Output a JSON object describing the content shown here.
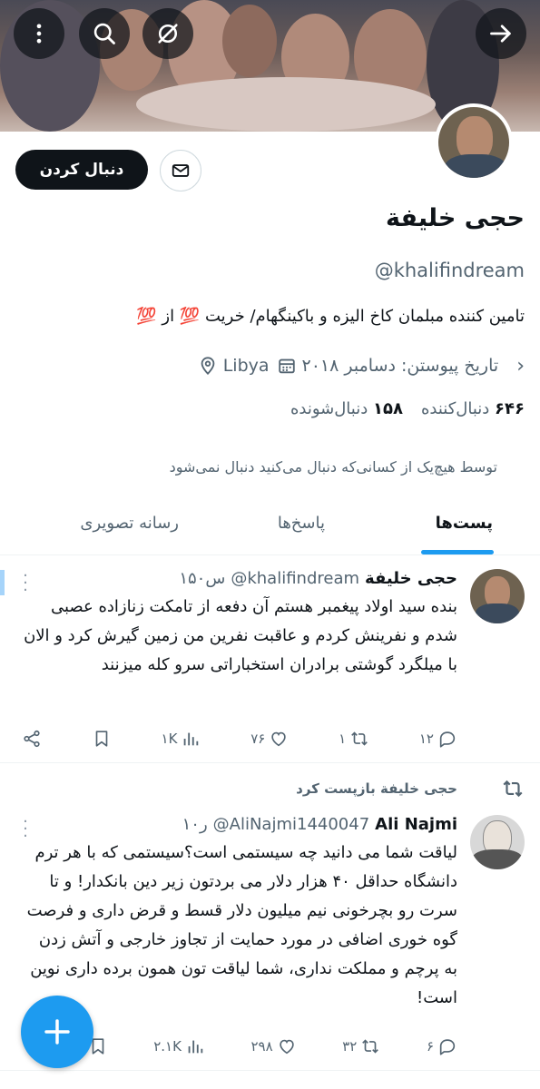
{
  "profile": {
    "name": "حجی خلیفة",
    "handle": "@khalifindream",
    "bio": "تامین کننده مبلمان کاخ الیزه و باکینگهام/ خریت 💯 از 💯",
    "location": "Libya",
    "joined": "تاریخ پیوستن: دسامبر ۲۰۱۸",
    "following_count": "۱۵۸",
    "following_label": "دنبال‌شونده",
    "followers_count": "۶۴۶",
    "followers_label": "دنبال‌کننده",
    "not_followed_text": "توسط هیچ‌یک از کسانی‌که دنبال می‌کنید دنبال نمی‌شود"
  },
  "header": {
    "follow_label": "دنبال کردن"
  },
  "tabs": [
    {
      "label": "پست‌ها",
      "active": true
    },
    {
      "label": "پاسخ‌ها",
      "active": false
    },
    {
      "label": "رسانه تصویری",
      "active": false
    }
  ],
  "posts": [
    {
      "author": "حجی خلیفة",
      "handle": "@khalifindream",
      "time": "۱۵۰س",
      "text": "بنده سید اولاد پیغمبر هستم آن دفعه از تامکت زنازاده عصبی شدم و نفرینش کردم و عاقبت نفرین من زمین گیرش کرد و الان با میلگرد گوشتی برادران استخباراتی سرو کله میزنند",
      "replies": "۱۲",
      "reposts": "۱",
      "likes": "۷۶",
      "views": "۱K"
    },
    {
      "repost_label": "حجی خلیفة بازپست کرد",
      "author": "Ali Najmi",
      "handle": "@AliNajmi1440047",
      "time": "۱۰ر",
      "text": "لیاقت شما می دانید چه سیستمی است؟سیستمی که با هر ترم دانشگاه حداقل ۴۰ هزار دلار می بردتون زیر دین بانکدار! و تا سرت رو بچرخونی نیم میلیون دلار قسط و قرض داری و فرصت گوه خوری اضافی در مورد حمایت از تجاوز خارجی و آتش زدن به پرچم و مملکت نداری، شما لیاقت تون همون برده داری نوین است!",
      "replies": "۶",
      "reposts": "۳۲",
      "likes": "۲۹۸",
      "views": "۲.۱K"
    }
  ],
  "colors": {
    "accent": "#1d9bf0",
    "text": "#0f1419",
    "muted": "#536471"
  }
}
